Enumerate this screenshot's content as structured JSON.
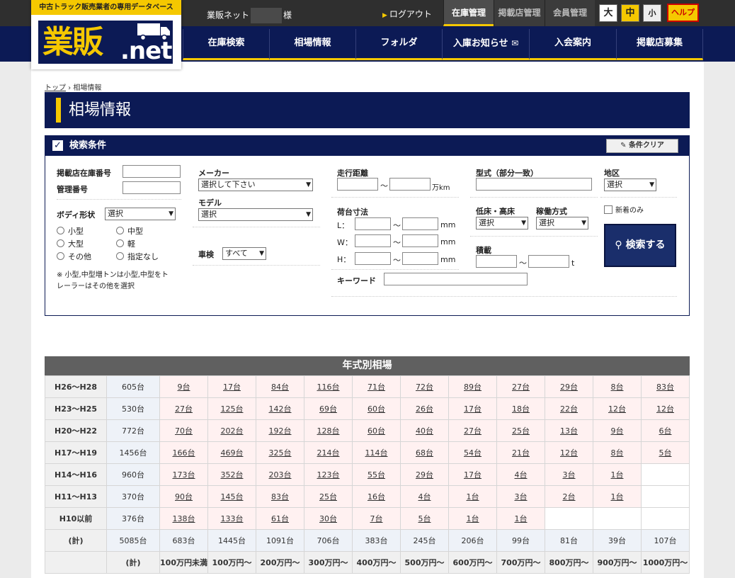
{
  "logo": {
    "caption": "中古トラック販売業者の専用データベース",
    "mark": "業販",
    "net": ".net"
  },
  "user": {
    "prefix": "業販ネット",
    "suffix": "様"
  },
  "logout": "ログアウト",
  "top_tabs": [
    "在庫管理",
    "掲載店管理",
    "会員管理"
  ],
  "font_sizes": [
    "大",
    "中",
    "小"
  ],
  "help": "ヘルプ",
  "nav": [
    "在庫検索",
    "相場情報",
    "フォルダ",
    "入庫お知らせ",
    "入会案内",
    "掲載店募集"
  ],
  "breadcrumb": {
    "top": "トップ",
    "sep": " › ",
    "current": "相場情報"
  },
  "page_title": "相場情報",
  "search": {
    "header": "検索条件",
    "check": "✓",
    "clear": "条件クリア",
    "listing_no": "掲載店在庫番号",
    "manage_no": "管理番号",
    "body_label": "ボディ形状",
    "body_value": "選択",
    "radios": [
      "小型",
      "中型",
      "大型",
      "軽",
      "その他",
      "指定なし"
    ],
    "note": "※ 小型,中型増トンは小型,中型をトレーラーはその他を選択",
    "maker_label": "メーカー",
    "maker_value": "選択して下さい",
    "model_label": "モデル",
    "model_value": "選択",
    "inspection_label": "車検",
    "inspection_value": "すべて",
    "mileage_label": "走行距離",
    "mileage_unit": "万km",
    "tilde": "～",
    "bed_label": "荷台寸法",
    "l": "L：",
    "w": "W：",
    "h": "H：",
    "mm": "mm",
    "keyword_label": "キーワード",
    "type_label": "型式（部分一致）",
    "floor_label": "低床・高床",
    "floor_value": "選択",
    "operation_label": "稼働方式",
    "operation_value": "選択",
    "load_label": "積載",
    "load_unit": "t",
    "region_label": "地区",
    "region_value": "選択",
    "new_only": "新着のみ",
    "submit": "検索する"
  },
  "table": {
    "title": "年式別相場",
    "rows": [
      {
        "label": "H26〜H28",
        "total": "605台",
        "cells": [
          "9台",
          "17台",
          "84台",
          "116台",
          "71台",
          "72台",
          "89台",
          "27台",
          "29台",
          "8台",
          "83台"
        ]
      },
      {
        "label": "H23〜H25",
        "total": "530台",
        "cells": [
          "27台",
          "125台",
          "142台",
          "69台",
          "60台",
          "26台",
          "17台",
          "18台",
          "22台",
          "12台",
          "12台"
        ]
      },
      {
        "label": "H20〜H22",
        "total": "772台",
        "cells": [
          "70台",
          "202台",
          "192台",
          "128台",
          "60台",
          "40台",
          "27台",
          "25台",
          "13台",
          "9台",
          "6台"
        ]
      },
      {
        "label": "H17〜H19",
        "total": "1456台",
        "cells": [
          "166台",
          "469台",
          "325台",
          "214台",
          "114台",
          "68台",
          "54台",
          "21台",
          "12台",
          "8台",
          "5台"
        ]
      },
      {
        "label": "H14〜H16",
        "total": "960台",
        "cells": [
          "173台",
          "352台",
          "203台",
          "123台",
          "55台",
          "29台",
          "17台",
          "4台",
          "3台",
          "1台",
          ""
        ]
      },
      {
        "label": "H11〜H13",
        "total": "370台",
        "cells": [
          "90台",
          "145台",
          "83台",
          "25台",
          "16台",
          "4台",
          "1台",
          "3台",
          "2台",
          "1台",
          ""
        ]
      },
      {
        "label": "H10以前",
        "total": "376台",
        "cells": [
          "138台",
          "133台",
          "61台",
          "30台",
          "7台",
          "5台",
          "1台",
          "1台",
          "",
          "",
          ""
        ]
      }
    ],
    "sum": {
      "label": "(計)",
      "total": "5085台",
      "cells": [
        "683台",
        "1445台",
        "1091台",
        "706台",
        "383台",
        "245台",
        "206台",
        "99台",
        "81台",
        "39台",
        "107台"
      ]
    },
    "header": {
      "blank": "",
      "total": "(計)",
      "cells": [
        "100万円未満",
        "100万円〜",
        "200万円〜",
        "300万円〜",
        "400万円〜",
        "500万円〜",
        "600万円〜",
        "700万円〜",
        "800万円〜",
        "900万円〜",
        "1000万円〜"
      ]
    }
  }
}
